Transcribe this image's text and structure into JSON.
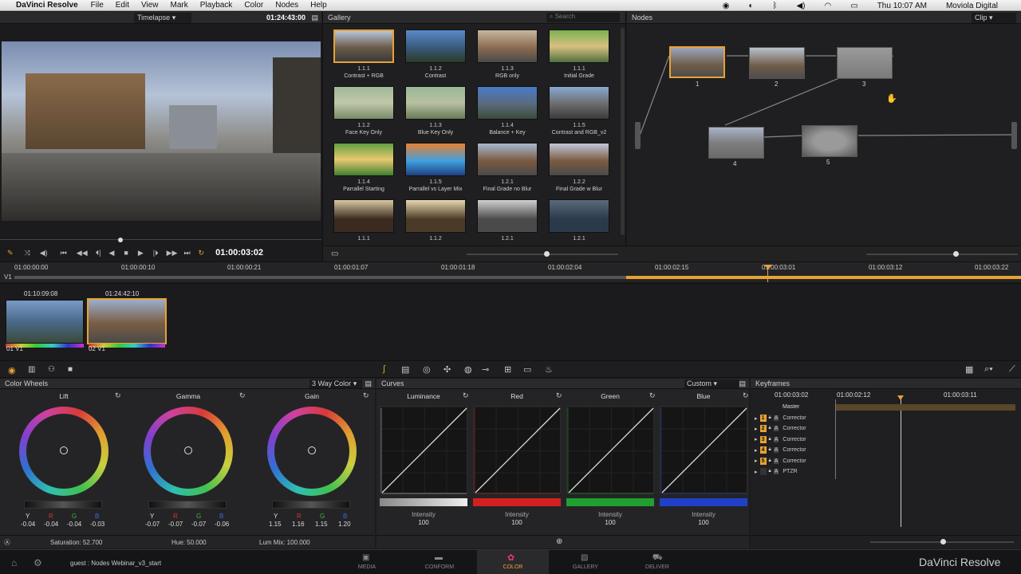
{
  "menubar": {
    "app": "DaVinci Resolve",
    "items": [
      "File",
      "Edit",
      "View",
      "Mark",
      "Playback",
      "Color",
      "Nodes",
      "Help"
    ],
    "clock": "Thu 10:07 AM",
    "user": "Moviola Digital"
  },
  "viewer": {
    "mode": "Timelapse",
    "timecode": "01:24:43:00",
    "playhead": "01:00:03:02"
  },
  "gallery": {
    "title": "Gallery",
    "search_placeholder": "Search",
    "items": [
      {
        "id": "1.1.1",
        "name": "Contrast + RGB"
      },
      {
        "id": "1.1.2",
        "name": "Contrast"
      },
      {
        "id": "1.1.3",
        "name": "RGB only"
      },
      {
        "id": "1.1.1",
        "name": "Initial Grade"
      },
      {
        "id": "1.1.2",
        "name": "Face Key Only"
      },
      {
        "id": "1.1.3",
        "name": "Blue Key Only"
      },
      {
        "id": "1.1.4",
        "name": "Balance + Key"
      },
      {
        "id": "1.1.5",
        "name": "Contrast and RGB_v2"
      },
      {
        "id": "1.1.4",
        "name": "Parrallel Starting"
      },
      {
        "id": "1.1.5",
        "name": "Parrallel vs Layer Mix"
      },
      {
        "id": "1.2.1",
        "name": "Final Grade no Blur"
      },
      {
        "id": "1.2.2",
        "name": "Final Grade w Blur"
      },
      {
        "id": "1.1.1",
        "name": ""
      },
      {
        "id": "1.1.2",
        "name": ""
      },
      {
        "id": "1.2.1",
        "name": ""
      },
      {
        "id": "1.2.1",
        "name": ""
      }
    ]
  },
  "nodes": {
    "title": "Nodes",
    "mode": "Clip",
    "labels": [
      "1",
      "2",
      "3",
      "4",
      "5"
    ]
  },
  "timeline": {
    "track": "V1",
    "ticks": [
      "01:00:00:00",
      "01:00:00:10",
      "01:00:00:21",
      "01:00:01:07",
      "01:00:01:18",
      "01:00:02:04",
      "01:00:02:15",
      "01:00:03:01",
      "01:00:03:12",
      "01:00:03:22"
    ]
  },
  "clips": [
    {
      "tc": "01:10:09:08",
      "label": "01 V1"
    },
    {
      "tc": "01:24:42:10",
      "label": "02 V1"
    }
  ],
  "colorwheels": {
    "title": "Color Wheels",
    "mode": "3 Way Color",
    "wheels": [
      {
        "name": "Lift",
        "vals": [
          "-0.04",
          "-0.04",
          "-0.04",
          "-0.03"
        ]
      },
      {
        "name": "Gamma",
        "vals": [
          "-0.07",
          "-0.07",
          "-0.07",
          "-0.06"
        ]
      },
      {
        "name": "Gain",
        "vals": [
          "1.15",
          "1.16",
          "1.15",
          "1.20"
        ]
      }
    ],
    "channels": [
      "Y",
      "R",
      "G",
      "B"
    ],
    "saturation": "Saturation: 52.700",
    "hue": "Hue: 50.000",
    "lummix": "Lum Mix: 100.000"
  },
  "curves": {
    "title": "Curves",
    "mode": "Custom",
    "channels": [
      "Luminance",
      "Red",
      "Green",
      "Blue"
    ],
    "intensity_label": "Intensity",
    "intensity_value": "100",
    "colors": [
      "#c8c8c8",
      "#d42020",
      "#20a030",
      "#2040c8"
    ]
  },
  "keyframes": {
    "title": "Keyframes",
    "tc": [
      "01:00:03:02",
      "01:00:02:12",
      "01:00:03:11"
    ],
    "master": "Master",
    "rows": [
      {
        "n": "1",
        "name": "Corrector"
      },
      {
        "n": "2",
        "name": "Corrector"
      },
      {
        "n": "3",
        "name": "Corrector"
      },
      {
        "n": "4",
        "name": "Corrector"
      },
      {
        "n": "5",
        "name": "Corrector"
      },
      {
        "n": "",
        "name": "PTZR"
      }
    ]
  },
  "bottombar": {
    "project": "guest : Nodes Webinar_v3_start",
    "tabs": [
      "MEDIA",
      "CONFORM",
      "COLOR",
      "GALLERY",
      "DELIVER"
    ],
    "brand": "DaVinci Resolve"
  }
}
